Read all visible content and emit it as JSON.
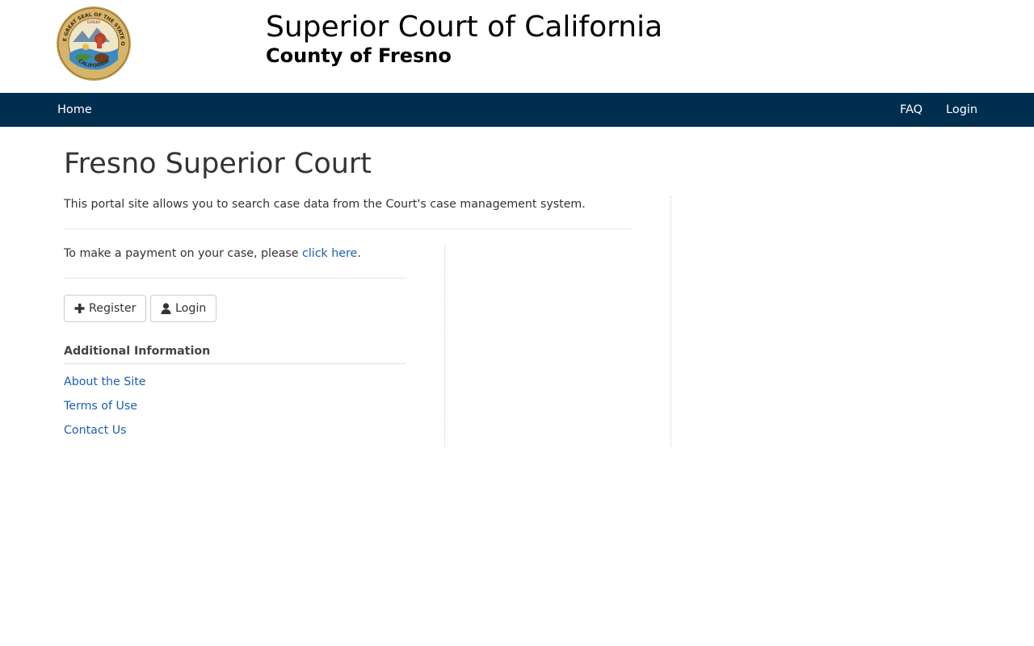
{
  "header": {
    "title": "Superior Court of California",
    "county": "County of Fresno",
    "seal": {
      "name": "great-seal-of-california",
      "text": "THE GREAT SEAL OF THE STATE OF CALIFORNIA",
      "motto": "EUREKA"
    }
  },
  "navbar": {
    "home": "Home",
    "faq": "FAQ",
    "login": "Login"
  },
  "main": {
    "title": "Fresno Superior Court",
    "intro": "This portal site allows you to search case data from the Court's case management system.",
    "payment_prefix": "To make a payment on your case, please ",
    "payment_link": "click here",
    "payment_suffix": ".",
    "register_label": "Register",
    "login_label": "Login",
    "additional_heading": "Additional Information",
    "links": [
      "About the Site",
      "Terms of Use",
      "Contact Us"
    ]
  },
  "colors": {
    "navbar_bg": "#002e4f",
    "link": "#1a5fb4"
  },
  "icons": {
    "register": "plus-icon",
    "login": "user-icon"
  }
}
